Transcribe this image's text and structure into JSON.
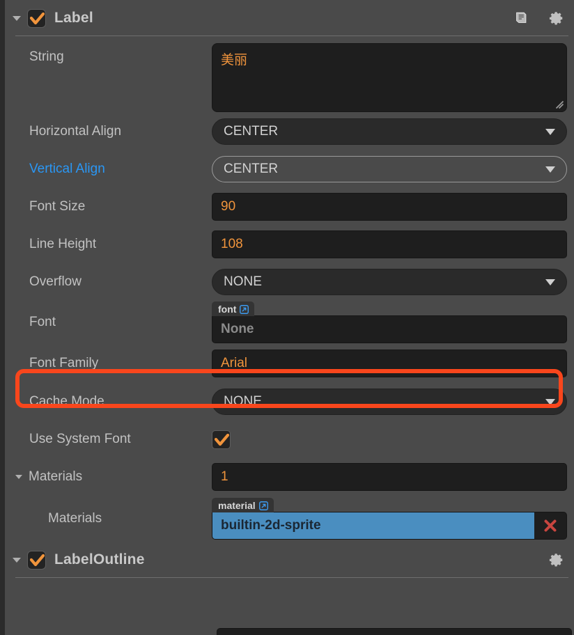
{
  "components": [
    {
      "name": "label-component",
      "title": "Label",
      "enabled": true,
      "collapsed": false,
      "icons": [
        "book-icon",
        "gear-icon"
      ]
    },
    {
      "name": "labeloutline-component",
      "title": "LabelOutline",
      "enabled": true,
      "collapsed": false,
      "icons": [
        "gear-icon"
      ]
    }
  ],
  "properties": {
    "string": {
      "label": "String",
      "value": "美丽"
    },
    "horizontal_align": {
      "label": "Horizontal Align",
      "value": "CENTER"
    },
    "vertical_align": {
      "label": "Vertical Align",
      "value": "CENTER"
    },
    "font_size": {
      "label": "Font Size",
      "value": "90"
    },
    "line_height": {
      "label": "Line Height",
      "value": "108"
    },
    "overflow": {
      "label": "Overflow",
      "value": "NONE"
    },
    "font": {
      "label": "Font",
      "badge": "font",
      "value": "None"
    },
    "font_family": {
      "label": "Font Family",
      "value": "Arial"
    },
    "cache_mode": {
      "label": "Cache Mode",
      "value": "NONE"
    },
    "use_system_font": {
      "label": "Use System Font",
      "checked": true
    },
    "materials_group": {
      "label": "Materials",
      "count": "1"
    },
    "materials_item": {
      "label": "Materials",
      "badge": "material",
      "value": "builtin-2d-sprite"
    }
  },
  "colors": {
    "panel_bg": "#4a4a4a",
    "field_bg": "#1e1e1e",
    "value_orange": "#f0943c",
    "label_gray": "#c2c2c2",
    "label_blue": "#2a97f5",
    "highlight_red": "#f9461c",
    "selected_blue": "#4a8ec0",
    "remove_red": "#c8453f"
  },
  "highlight": {
    "target": "font-family-row"
  }
}
